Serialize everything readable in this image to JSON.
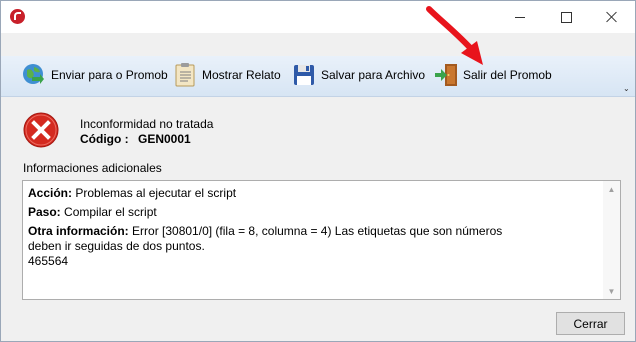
{
  "window": {
    "controls": {
      "minimize": "minimize",
      "maximize": "maximize",
      "close": "close"
    }
  },
  "toolbar": {
    "send_label": "Enviar para o Promob",
    "report_label": "Mostrar Relato",
    "save_label": "Salvar para Archivo",
    "exit_label": "Salir del Promob",
    "overflow_glyph": "⌄"
  },
  "annotation": {
    "arrow_color": "#e8141c"
  },
  "error": {
    "title": "Inconformidad no tratada",
    "code_label": "Código :",
    "code_value": "GEN0001"
  },
  "details": {
    "section_label": "Informaciones adicionales",
    "action_label": "Acción:",
    "action_value": "Problemas al ejecutar el script",
    "step_label": "Paso:",
    "step_value": "Compilar el script",
    "other_label": "Otra información:",
    "other_line1": "Error [30801/0] (fila = 8, columna = 4) Las etiquetas que son números",
    "other_line2": "deben ir seguidas de dos puntos.",
    "other_line3": "465564"
  },
  "footer": {
    "close_label": "Cerrar"
  },
  "colors": {
    "toolbar_top": "#e9f1fa",
    "toolbar_bottom": "#d7e5f4",
    "error_red": "#d42a20",
    "arrow_red": "#e8141c"
  }
}
